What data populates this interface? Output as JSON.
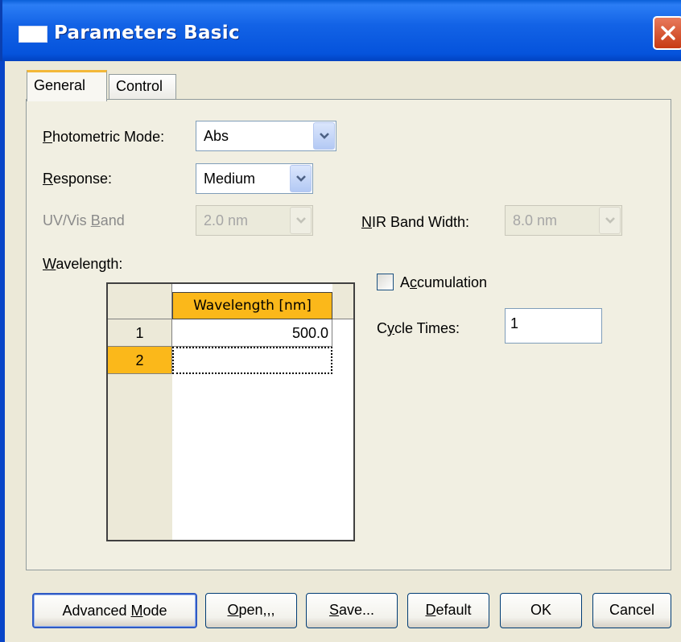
{
  "window": {
    "title": "Parameters  Basic"
  },
  "tabs": [
    {
      "label": "General",
      "active": true
    },
    {
      "label": "Control",
      "active": false
    }
  ],
  "photometric_mode": {
    "label_key": "P",
    "label_rest": "hotometric Mode:",
    "value": "Abs"
  },
  "response": {
    "label_key": "R",
    "label_rest": "esponse:",
    "value": "Medium"
  },
  "uvvis_band": {
    "label_pre": "UV/Vis ",
    "label_key": "B",
    "label_rest": "and",
    "value": "2.0 nm",
    "disabled": true
  },
  "nir_band": {
    "label_key": "N",
    "label_rest": "IR Band Width:",
    "value": "8.0 nm",
    "disabled": true
  },
  "wavelength": {
    "label_key": "W",
    "label_rest": "avelength:",
    "column_header": "Wavelength [nm]",
    "rows": [
      {
        "num": "1",
        "value": "500.0",
        "selected": false
      },
      {
        "num": "2",
        "value": "",
        "selected": true
      }
    ]
  },
  "accumulation": {
    "label_pre": "A",
    "label_key": "c",
    "label_rest": "cumulation",
    "checked": false
  },
  "cycle_times": {
    "label_pre": "C",
    "label_key": "y",
    "label_rest": "cle Times:",
    "value": "1"
  },
  "buttons": {
    "advanced": {
      "pre": "Advanced ",
      "key": "M",
      "rest": "ode"
    },
    "open": {
      "pre": "",
      "key": "O",
      "rest": "pen,,,"
    },
    "save": {
      "pre": "",
      "key": "S",
      "rest": "ave..."
    },
    "default": {
      "pre": "",
      "key": "D",
      "rest": "efault"
    },
    "ok": {
      "label": "OK"
    },
    "cancel": {
      "label": "Cancel"
    }
  },
  "colors": {
    "accent": "#fbb81a",
    "titlebar": "#0553dc"
  }
}
